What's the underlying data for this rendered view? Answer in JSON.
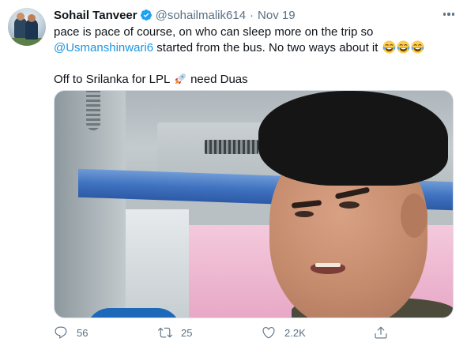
{
  "tweet": {
    "author_name": "Sohail Tanveer",
    "handle": "@sohailmalik614",
    "separator": "·",
    "time": "Nov 19",
    "text_line1": "pace is pace of course, on who can sleep more on the trip so",
    "mention": "@Usmanshinwari6",
    "text_line2_rest": " started from the bus. No two ways about it",
    "text_line3": "Off to Srilanka for LPL",
    "text_line3_rest": " need Duas",
    "emojis": [
      "face-with-tears-of-joy",
      "face-with-tears-of-joy",
      "face-with-tears-of-joy",
      "rocket"
    ],
    "media_description_icon": "photo-selfie-in-bus"
  },
  "actions": {
    "reply_count": "56",
    "retweet_count": "25",
    "like_count": "2.2K"
  },
  "colors": {
    "text": "#0f1419",
    "secondary": "#5b7083",
    "link": "#1b95e0",
    "verified": "#1da1f2"
  }
}
